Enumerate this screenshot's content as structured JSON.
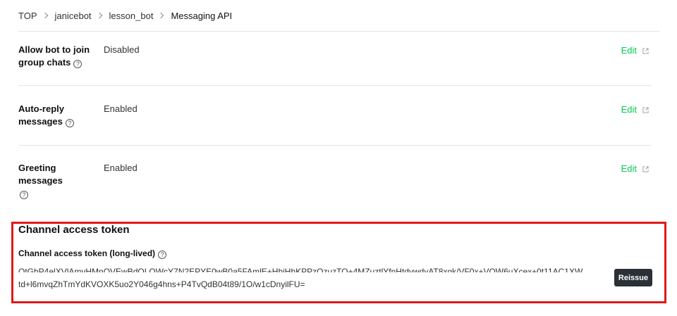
{
  "breadcrumb": [
    {
      "label": "TOP"
    },
    {
      "label": "janicebot"
    },
    {
      "label": "lesson_bot"
    },
    {
      "label": "Messaging API"
    }
  ],
  "settings": [
    {
      "label": "Allow bot to join group chats",
      "value": "Disabled",
      "action": "Edit"
    },
    {
      "label": "Auto-reply messages",
      "value": "Enabled",
      "action": "Edit"
    },
    {
      "label": "Greeting messages",
      "value": "Enabled",
      "action": "Edit"
    }
  ],
  "token": {
    "title": "Channel access token",
    "subtitle": "Channel access token (long-lived)",
    "value_line1": "OtGhP4elXVlAmvHMnOVEwBdOLOWcY7N2EPYE0wB0a5FAmlE+HhiHhKPPzOzuzTO+4MZuztlYfnHtdvwdyAT8xgk/VF0x+VOW6uXcex+0t11AC1XW",
    "value_line2": "td+l6mvqZhTmYdKVOXK5uo2Y046g4hns+P4TvQdB04t89/1O/w1cDnyilFU=",
    "reissue_label": "Reissue"
  },
  "colors": {
    "accent_green": "#06c755",
    "highlight_red": "#e01818",
    "button_dark": "#2b2f36"
  },
  "icons": {
    "help": "question-circle-icon",
    "external": "external-link-icon",
    "separator": "chevron-right-icon"
  }
}
